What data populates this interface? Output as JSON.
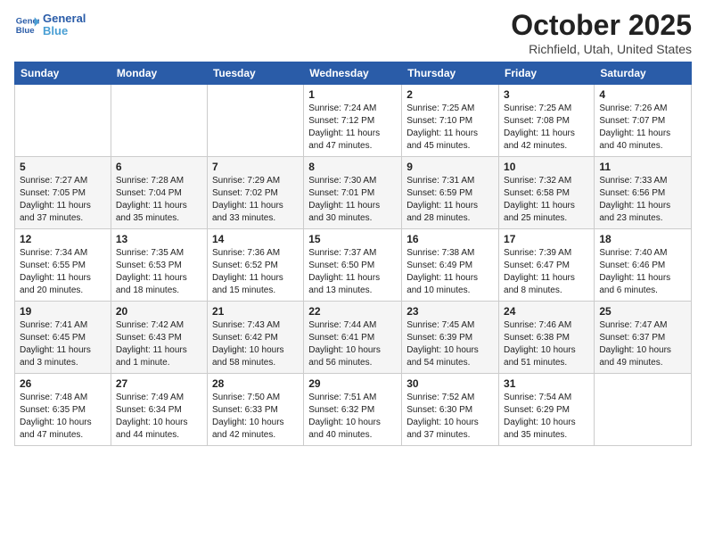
{
  "header": {
    "logo_line1": "General",
    "logo_line2": "Blue",
    "month": "October 2025",
    "location": "Richfield, Utah, United States"
  },
  "weekdays": [
    "Sunday",
    "Monday",
    "Tuesday",
    "Wednesday",
    "Thursday",
    "Friday",
    "Saturday"
  ],
  "weeks": [
    [
      {
        "day": "",
        "info": ""
      },
      {
        "day": "",
        "info": ""
      },
      {
        "day": "",
        "info": ""
      },
      {
        "day": "1",
        "info": "Sunrise: 7:24 AM\nSunset: 7:12 PM\nDaylight: 11 hours\nand 47 minutes."
      },
      {
        "day": "2",
        "info": "Sunrise: 7:25 AM\nSunset: 7:10 PM\nDaylight: 11 hours\nand 45 minutes."
      },
      {
        "day": "3",
        "info": "Sunrise: 7:25 AM\nSunset: 7:08 PM\nDaylight: 11 hours\nand 42 minutes."
      },
      {
        "day": "4",
        "info": "Sunrise: 7:26 AM\nSunset: 7:07 PM\nDaylight: 11 hours\nand 40 minutes."
      }
    ],
    [
      {
        "day": "5",
        "info": "Sunrise: 7:27 AM\nSunset: 7:05 PM\nDaylight: 11 hours\nand 37 minutes."
      },
      {
        "day": "6",
        "info": "Sunrise: 7:28 AM\nSunset: 7:04 PM\nDaylight: 11 hours\nand 35 minutes."
      },
      {
        "day": "7",
        "info": "Sunrise: 7:29 AM\nSunset: 7:02 PM\nDaylight: 11 hours\nand 33 minutes."
      },
      {
        "day": "8",
        "info": "Sunrise: 7:30 AM\nSunset: 7:01 PM\nDaylight: 11 hours\nand 30 minutes."
      },
      {
        "day": "9",
        "info": "Sunrise: 7:31 AM\nSunset: 6:59 PM\nDaylight: 11 hours\nand 28 minutes."
      },
      {
        "day": "10",
        "info": "Sunrise: 7:32 AM\nSunset: 6:58 PM\nDaylight: 11 hours\nand 25 minutes."
      },
      {
        "day": "11",
        "info": "Sunrise: 7:33 AM\nSunset: 6:56 PM\nDaylight: 11 hours\nand 23 minutes."
      }
    ],
    [
      {
        "day": "12",
        "info": "Sunrise: 7:34 AM\nSunset: 6:55 PM\nDaylight: 11 hours\nand 20 minutes."
      },
      {
        "day": "13",
        "info": "Sunrise: 7:35 AM\nSunset: 6:53 PM\nDaylight: 11 hours\nand 18 minutes."
      },
      {
        "day": "14",
        "info": "Sunrise: 7:36 AM\nSunset: 6:52 PM\nDaylight: 11 hours\nand 15 minutes."
      },
      {
        "day": "15",
        "info": "Sunrise: 7:37 AM\nSunset: 6:50 PM\nDaylight: 11 hours\nand 13 minutes."
      },
      {
        "day": "16",
        "info": "Sunrise: 7:38 AM\nSunset: 6:49 PM\nDaylight: 11 hours\nand 10 minutes."
      },
      {
        "day": "17",
        "info": "Sunrise: 7:39 AM\nSunset: 6:47 PM\nDaylight: 11 hours\nand 8 minutes."
      },
      {
        "day": "18",
        "info": "Sunrise: 7:40 AM\nSunset: 6:46 PM\nDaylight: 11 hours\nand 6 minutes."
      }
    ],
    [
      {
        "day": "19",
        "info": "Sunrise: 7:41 AM\nSunset: 6:45 PM\nDaylight: 11 hours\nand 3 minutes."
      },
      {
        "day": "20",
        "info": "Sunrise: 7:42 AM\nSunset: 6:43 PM\nDaylight: 11 hours\nand 1 minute."
      },
      {
        "day": "21",
        "info": "Sunrise: 7:43 AM\nSunset: 6:42 PM\nDaylight: 10 hours\nand 58 minutes."
      },
      {
        "day": "22",
        "info": "Sunrise: 7:44 AM\nSunset: 6:41 PM\nDaylight: 10 hours\nand 56 minutes."
      },
      {
        "day": "23",
        "info": "Sunrise: 7:45 AM\nSunset: 6:39 PM\nDaylight: 10 hours\nand 54 minutes."
      },
      {
        "day": "24",
        "info": "Sunrise: 7:46 AM\nSunset: 6:38 PM\nDaylight: 10 hours\nand 51 minutes."
      },
      {
        "day": "25",
        "info": "Sunrise: 7:47 AM\nSunset: 6:37 PM\nDaylight: 10 hours\nand 49 minutes."
      }
    ],
    [
      {
        "day": "26",
        "info": "Sunrise: 7:48 AM\nSunset: 6:35 PM\nDaylight: 10 hours\nand 47 minutes."
      },
      {
        "day": "27",
        "info": "Sunrise: 7:49 AM\nSunset: 6:34 PM\nDaylight: 10 hours\nand 44 minutes."
      },
      {
        "day": "28",
        "info": "Sunrise: 7:50 AM\nSunset: 6:33 PM\nDaylight: 10 hours\nand 42 minutes."
      },
      {
        "day": "29",
        "info": "Sunrise: 7:51 AM\nSunset: 6:32 PM\nDaylight: 10 hours\nand 40 minutes."
      },
      {
        "day": "30",
        "info": "Sunrise: 7:52 AM\nSunset: 6:30 PM\nDaylight: 10 hours\nand 37 minutes."
      },
      {
        "day": "31",
        "info": "Sunrise: 7:54 AM\nSunset: 6:29 PM\nDaylight: 10 hours\nand 35 minutes."
      },
      {
        "day": "",
        "info": ""
      }
    ]
  ]
}
